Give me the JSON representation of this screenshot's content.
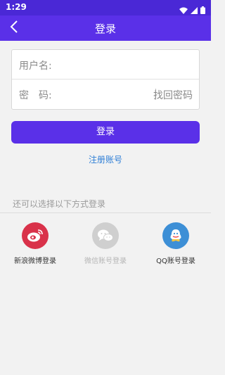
{
  "status_bar": {
    "time": "1:29",
    "icons": [
      "wifi-icon",
      "signal-icon",
      "battery-icon"
    ]
  },
  "app_bar": {
    "title": "登录",
    "back_icon": "chevron-left-icon"
  },
  "form": {
    "username_label": "用户名:",
    "username_value": "",
    "password_label": "密　码:",
    "password_value": "",
    "forgot_password_label": "找回密码"
  },
  "login_button_label": "登录",
  "register_label": "注册账号",
  "third_party": {
    "heading": "还可以选择以下方式登录",
    "options": [
      {
        "label": "新浪微博登录",
        "icon": "weibo-icon",
        "color": "#d9324a",
        "enabled": true
      },
      {
        "label": "微信账号登录",
        "icon": "wechat-icon",
        "color": "#cfcfcf",
        "enabled": false
      },
      {
        "label": "QQ账号登录",
        "icon": "qq-icon",
        "color": "#3d8fd6",
        "enabled": true
      }
    ]
  },
  "colors": {
    "primary": "#5a30e8",
    "status_bar": "#4a28d6",
    "link": "#2f7fd6"
  }
}
